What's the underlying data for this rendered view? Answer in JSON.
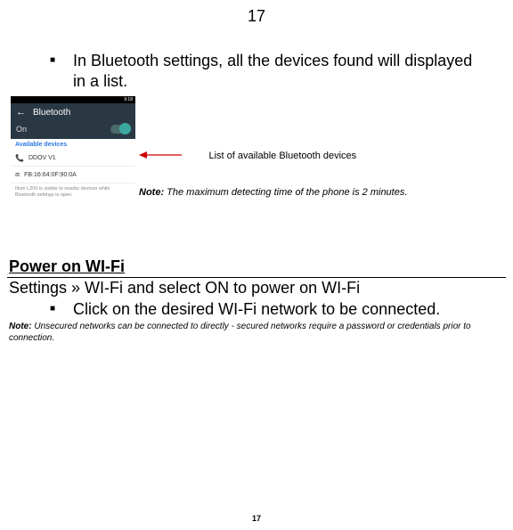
{
  "page_number_top": "17",
  "page_number_bottom": "17",
  "bullet1": "In Bluetooth settings, all the devices found will displayed in a list.",
  "phone": {
    "status_left": "",
    "status_right_time": "9:18",
    "header_title": "Bluetooth",
    "on_label": "On",
    "available_label": "Available devices",
    "devices": [
      {
        "icon": "📞",
        "name": "DDOV V1"
      },
      {
        "icon": "⧈",
        "name": "FB:16:64:0F:90:0A"
      }
    ],
    "visible_note": "Ilium L200 is visible to nearby devices while Bluetooth settings is open."
  },
  "list_label": "List of available Bluetooth devices",
  "detect_note_label": "Note:",
  "detect_note_text": " The maximum detecting time of the phone is 2 minutes.",
  "section_heading": "Power on WI-Fi",
  "settings_path": "Settings » WI-Fi and select ON to power on WI-Fi",
  "bullet2": "Click on the desired WI-Fi network to be connected.",
  "wifi_note_label": "Note:",
  "wifi_note_text": " Unsecured networks can be connected to directly - secured networks require a password or credentials prior to connection."
}
